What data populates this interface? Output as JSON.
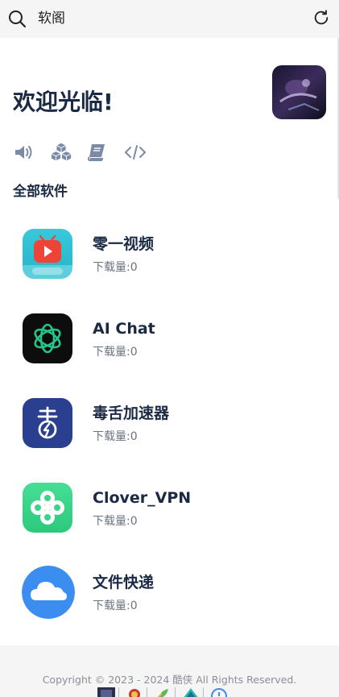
{
  "topbar": {
    "title": "软阁"
  },
  "main": {
    "welcome": "欢迎光临!",
    "tools": [
      "speaker-icon",
      "cubes-icon",
      "book-icon",
      "code-icon"
    ],
    "section_title": "全部软件"
  },
  "apps": [
    {
      "name": "零一视频",
      "downloads": "下载量:0",
      "icon": "video-app-icon",
      "color": "#2fc0d3"
    },
    {
      "name": "AI Chat",
      "downloads": "下载量:0",
      "icon": "ai-chat-app-icon",
      "color": "#0d0d0d"
    },
    {
      "name": "毒舌加速器",
      "downloads": "下载量:0",
      "icon": "accelerator-app-icon",
      "color": "#2a3f8f"
    },
    {
      "name": "Clover_VPN",
      "downloads": "下载量:0",
      "icon": "clover-vpn-app-icon",
      "color": "#3ad58a"
    },
    {
      "name": "文件快递",
      "downloads": "下载量:0",
      "icon": "cloud-transfer-app-icon",
      "color": "#3b8df0"
    }
  ],
  "footer": {
    "copyright": "Copyright © 2023 - 2024 酷侠 All Rights Reserved."
  },
  "colors": {
    "text_primary": "#1b2a44",
    "text_secondary": "#6b7280",
    "tool_icon": "#7b8aa6",
    "background": "#f5f5f5"
  }
}
